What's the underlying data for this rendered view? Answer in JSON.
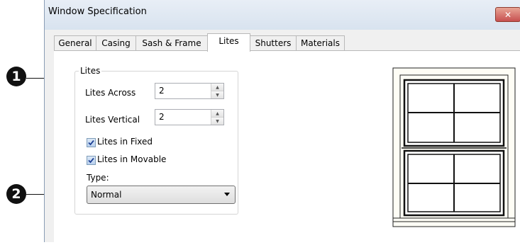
{
  "callouts": [
    "1",
    "2"
  ],
  "window": {
    "title": "Window Specification",
    "close_glyph": "✕"
  },
  "tabs": [
    {
      "label": "General"
    },
    {
      "label": "Casing"
    },
    {
      "label": "Sash & Frame"
    },
    {
      "label": "Lites",
      "active": true
    },
    {
      "label": "Shutters"
    },
    {
      "label": "Materials"
    }
  ],
  "lites_group": {
    "legend": "Lites",
    "across_label": "Lites Across",
    "across_value": "2",
    "vertical_label": "Lites Vertical",
    "vertical_value": "2",
    "fixed_label": "Lites in Fixed",
    "fixed_checked": true,
    "movable_label": "Lites in Movable",
    "movable_checked": true,
    "type_label": "Type:",
    "type_value": "Normal"
  },
  "icons": {
    "spin_up": "spin-up-arrow-icon",
    "spin_down": "spin-down-arrow-icon",
    "dropdown": "chevron-down-icon",
    "check": "checkmark-icon"
  },
  "colors": {
    "close_button": "#c75050",
    "titlebar": "#dce6f1"
  }
}
